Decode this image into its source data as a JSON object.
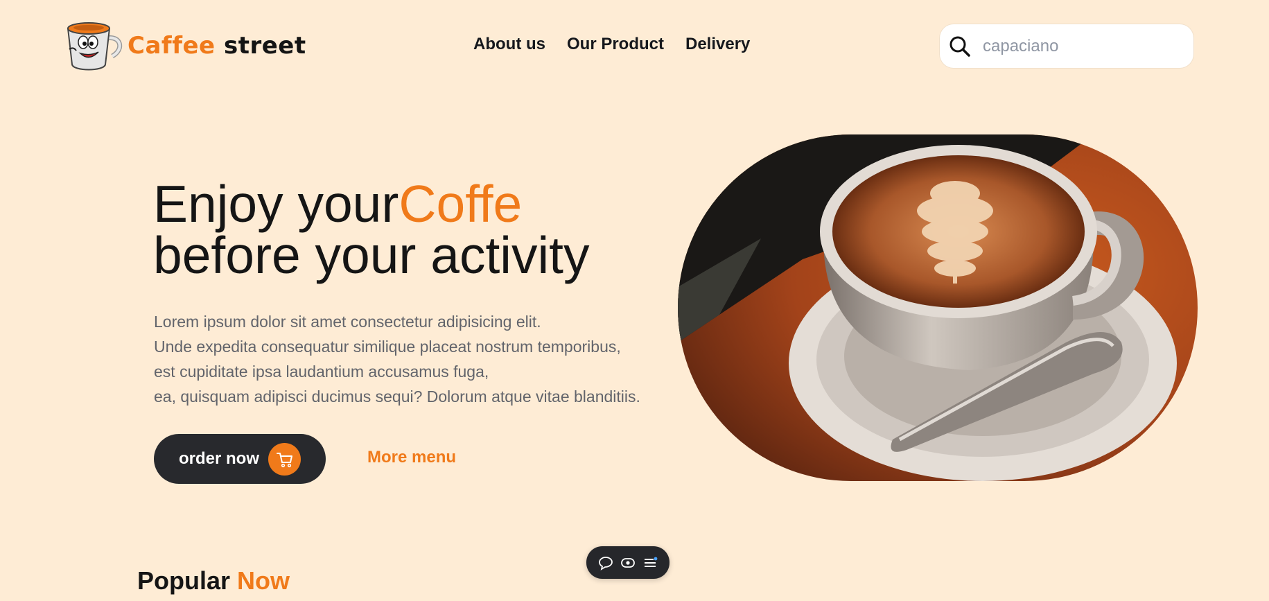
{
  "brand": {
    "name_part1": "Caffee",
    "name_part2": "street",
    "logo_icon": "coffee-cup-mascot-icon"
  },
  "nav": {
    "items": [
      {
        "label": "About us"
      },
      {
        "label": "Our Product"
      },
      {
        "label": "Delivery"
      }
    ]
  },
  "search": {
    "placeholder": "capaciano",
    "icon": "search-icon"
  },
  "hero": {
    "title_line1_part1": "Enjoy your",
    "title_line1_accent": "Coffe",
    "title_line2": "before your activity",
    "description": [
      "Lorem ipsum dolor sit amet consectetur adipisicing elit.",
      "Unde expedita consequatur similique placeat nostrum temporibus,",
      "est cupiditate ipsa laudantium accusamus fuga,",
      "ea, quisquam adipisci ducimus sequi? Dolorum atque vitae blanditiis."
    ],
    "order_button": "order now",
    "order_icon": "cart-icon",
    "more_link": "More menu"
  },
  "toolbar": {
    "icons": [
      "comment-icon",
      "eye-icon",
      "menu-icon"
    ]
  },
  "popular": {
    "title": "Popular",
    "accent": "Now"
  },
  "colors": {
    "background": "#feecd5",
    "accent": "#f07a1a",
    "dark": "#28292d"
  }
}
